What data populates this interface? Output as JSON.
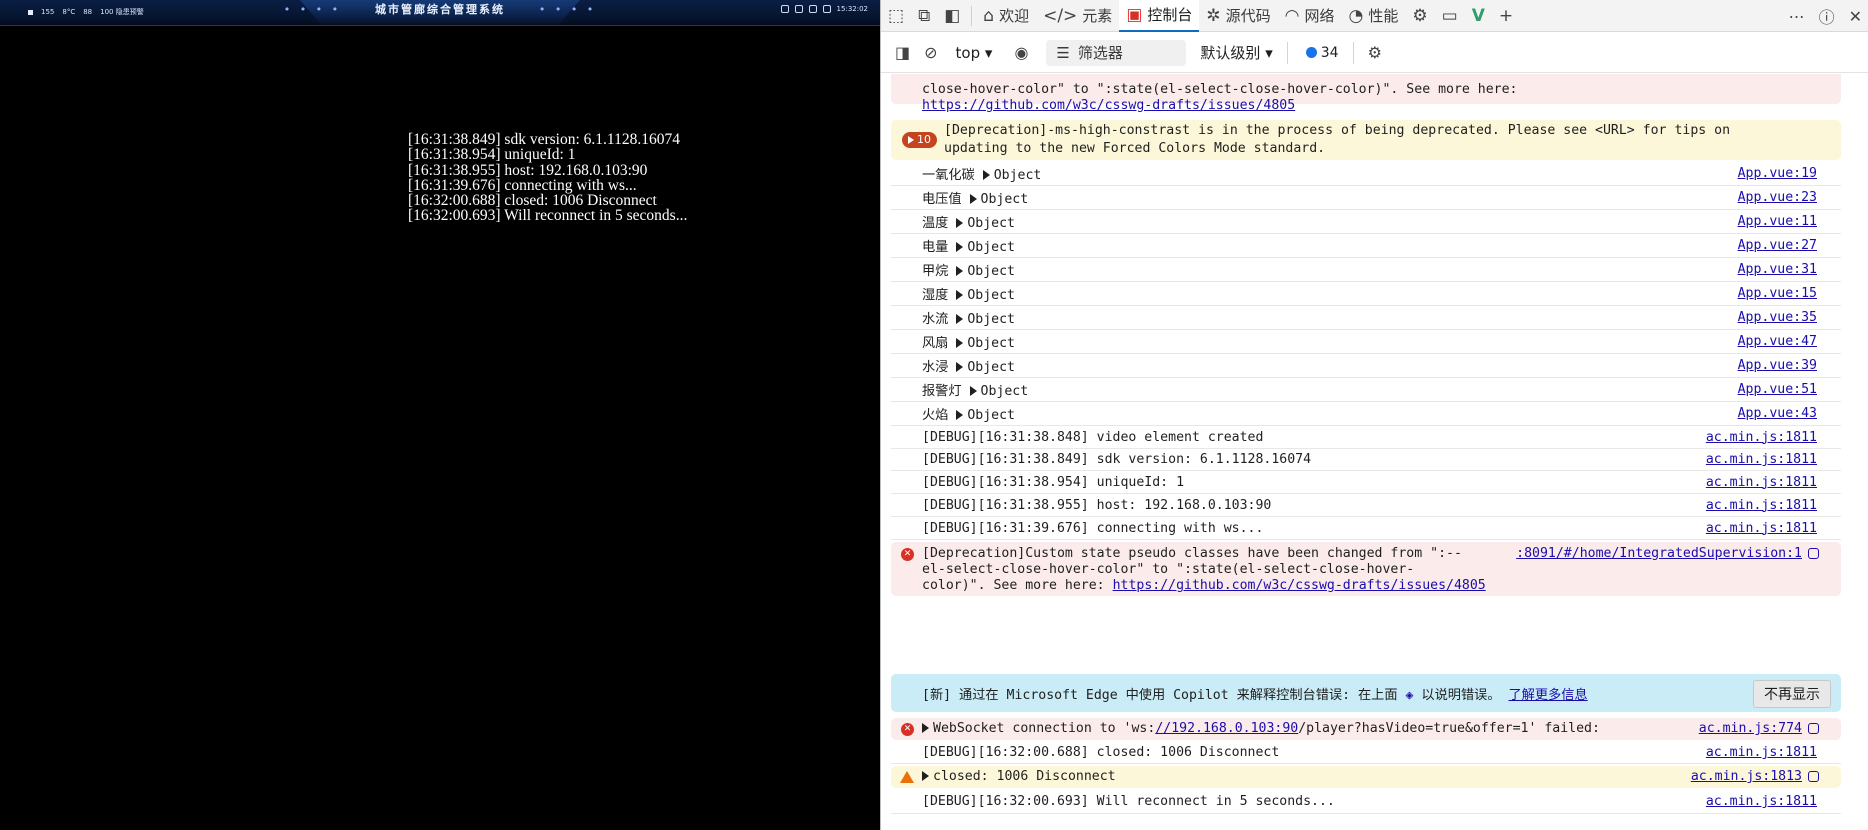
{
  "app": {
    "title": "城市管廊综合管理系统",
    "title_dots": "• • • •",
    "status_items": [
      "155",
      "8°C",
      "88",
      "100 隐患预警"
    ],
    "clock": "15:32:02",
    "log_lines": [
      "[16:31:38.849] sdk version: 6.1.1128.16074",
      "[16:31:38.954] uniqueId: 1",
      "[16:31:38.955] host: 192.168.0.103:90",
      "[16:31:39.676] connecting with ws...",
      "[16:32:00.688] closed: 1006 Disconnect",
      "[16:32:00.693] Will reconnect in 5 seconds..."
    ]
  },
  "devtools": {
    "tabs": {
      "welcome": "欢迎",
      "elements": "元素",
      "console": "控制台",
      "sources": "源代码",
      "network": "网络",
      "performance": "性能"
    },
    "toolbar": {
      "context": "top",
      "filter_placeholder": "筛选器",
      "level": "默认级别",
      "message_count": "34"
    },
    "top_error": {
      "line1": "close-hover-color\" to \":state(el-select-close-hover-color)\". See more here:",
      "link": "https://github.com/w3c/csswg-drafts/issues/4805"
    },
    "deprecation_warning": {
      "count": "10",
      "line1": "[Deprecation]-ms-high-constrast is in the process of being deprecated. Please see <URL> for tips on",
      "line2": "updating to the new Forced Colors Mode standard."
    },
    "object_rows": [
      {
        "label": "一氧化碳",
        "value": "Object",
        "src": "App.vue:19"
      },
      {
        "label": "电压值",
        "value": "Object",
        "src": "App.vue:23"
      },
      {
        "label": "温度",
        "value": "Object",
        "src": "App.vue:11"
      },
      {
        "label": "电量",
        "value": "Object",
        "src": "App.vue:27"
      },
      {
        "label": "甲烷",
        "value": "Object",
        "src": "App.vue:31"
      },
      {
        "label": "湿度",
        "value": "Object",
        "src": "App.vue:15"
      },
      {
        "label": "水流",
        "value": "Object",
        "src": "App.vue:35"
      },
      {
        "label": "风扇",
        "value": "Object",
        "src": "App.vue:47"
      },
      {
        "label": "水浸",
        "value": "Object",
        "src": "App.vue:39"
      },
      {
        "label": "报警灯",
        "value": "Object",
        "src": "App.vue:51"
      },
      {
        "label": "火焰",
        "value": "Object",
        "src": "App.vue:43"
      }
    ],
    "debug_rows": [
      {
        "text": "[DEBUG][16:31:38.848] video element created",
        "src": "ac.min.js:1811"
      },
      {
        "text": "[DEBUG][16:31:38.849] sdk version: 6.1.1128.16074",
        "src": "ac.min.js:1811"
      },
      {
        "text": "[DEBUG][16:31:38.954] uniqueId: 1",
        "src": "ac.min.js:1811"
      },
      {
        "text": "[DEBUG][16:31:38.955] host: 192.168.0.103:90",
        "src": "ac.min.js:1811"
      },
      {
        "text": "[DEBUG][16:31:39.676] connecting with ws...",
        "src": "ac.min.js:1811"
      }
    ],
    "css_error": {
      "line1": "[Deprecation]Custom state pseudo classes have been changed from \":--",
      "line2": "el-select-close-hover-color\" to \":state(el-select-close-hover-",
      "line3_prefix": "color)\". See more here: ",
      "link": "https://github.com/w3c/csswg-drafts/issues/4805",
      "src": ":8091/#/home/IntegratedSupervision:1"
    },
    "copilot_banner": {
      "text": "[新] 通过在 Microsoft Edge 中使用 Copilot 来解释控制台错误: 在上面",
      "text2": "以说明错误。",
      "link": "了解更多信息",
      "button": "不再显示"
    },
    "ws_error": {
      "prefix": "WebSocket connection to 'ws:",
      "link": "//192.168.0.103:90",
      "suffix": "/player?hasVideo=true&offer=1' failed:",
      "src": "ac.min.js:774"
    },
    "closed_debug": {
      "text": "[DEBUG][16:32:00.688] closed: 1006 Disconnect",
      "src": "ac.min.js:1811"
    },
    "closed_warning": {
      "text": "closed: 1006 Disconnect",
      "src": "ac.min.js:1813"
    },
    "reconnect_debug": {
      "text": "[DEBUG][16:32:00.693] Will reconnect in 5 seconds...",
      "src": "ac.min.js:1811"
    }
  }
}
